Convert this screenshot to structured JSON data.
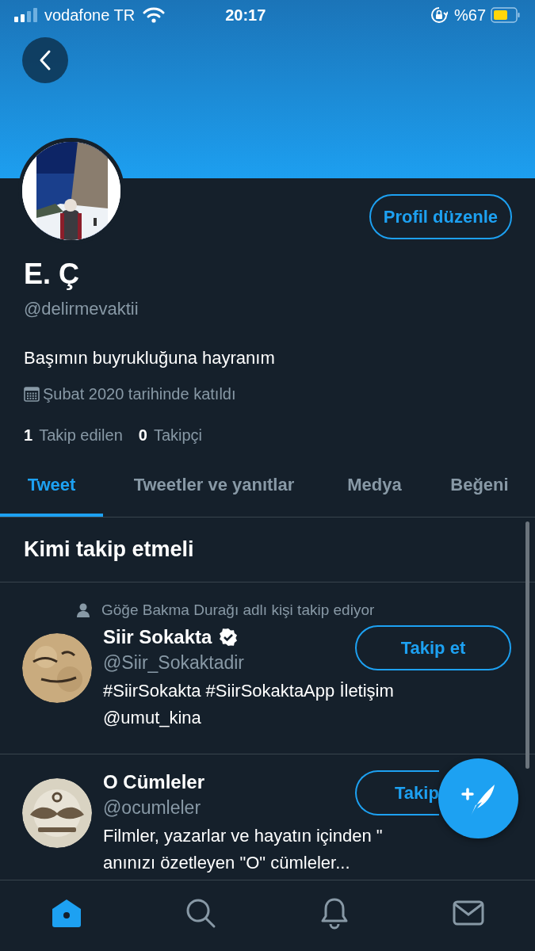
{
  "status_bar": {
    "carrier": "vodafone TR",
    "time": "20:17",
    "battery": "%67"
  },
  "profile": {
    "name": "E. Ç",
    "handle": "@delirmevaktii",
    "bio": "Başımın buyrukluğuna hayranım",
    "joined": "Şubat 2020 tarihinde katıldı",
    "edit_button": "Profil düzenle",
    "stats": [
      {
        "count": "1",
        "label": "Takip edilen"
      },
      {
        "count": "0",
        "label": "Takipçi"
      }
    ]
  },
  "tabs": [
    {
      "label": "Tweet",
      "selected": true
    },
    {
      "label": "Tweetler ve yanıtlar",
      "selected": false
    },
    {
      "label": "Medya",
      "selected": false
    },
    {
      "label": "Beğeni",
      "selected": false
    }
  ],
  "suggestions": {
    "title": "Kimi takip etmeli",
    "items": [
      {
        "context": "Göğe Bakma Durağı adlı kişi takip ediyor",
        "name": "Siir Sokakta",
        "verified": true,
        "handle": "@Siir_Sokaktadir",
        "button": "Takip et",
        "bio_lines": [
          "#SiirSokakta #SiirSokaktaApp İletişim",
          "@umut_kina"
        ]
      },
      {
        "name": "O Cümleler",
        "verified": false,
        "handle": "@ocumleler",
        "button": "Takip",
        "bio_lines": [
          "Filmler, yazarlar ve hayatın içinden \"",
          "anınızı özetleyen \"O\" cümleler..."
        ]
      }
    ]
  },
  "bottom_nav": [
    {
      "kind": "home",
      "selected": true
    },
    {
      "kind": "search",
      "selected": false
    },
    {
      "kind": "notifications",
      "selected": false
    },
    {
      "kind": "messages",
      "selected": false
    }
  ]
}
